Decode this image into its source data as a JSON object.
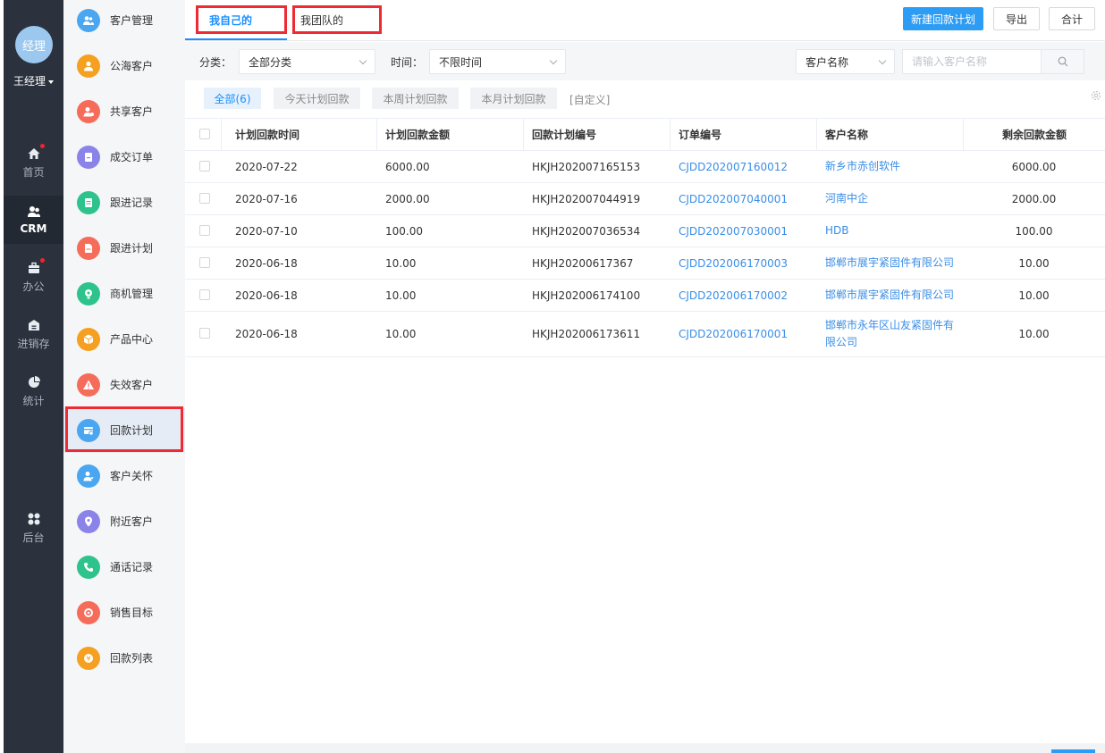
{
  "user": {
    "avatar_text": "经理",
    "name": "王经理"
  },
  "rail": [
    {
      "label": "首页",
      "icon": "home-icon",
      "badge": true
    },
    {
      "label": "CRM",
      "icon": "crm-icon",
      "badge": false,
      "active": true
    },
    {
      "label": "办公",
      "icon": "briefcase-icon",
      "badge": true
    },
    {
      "label": "进销存",
      "icon": "warehouse-icon",
      "badge": false
    },
    {
      "label": "统计",
      "icon": "pie-chart-icon",
      "badge": false
    },
    {
      "label": "后台",
      "icon": "admin-grid-icon",
      "badge": false
    }
  ],
  "menu": [
    {
      "label": "客户管理",
      "icon": "customers-icon",
      "color": "#4aa6f0"
    },
    {
      "label": "公海客户",
      "icon": "public-pool-icon",
      "color": "#f5a020"
    },
    {
      "label": "共享客户",
      "icon": "shared-customers-icon",
      "color": "#f56c5a"
    },
    {
      "label": "成交订单",
      "icon": "order-icon",
      "color": "#8b84e8"
    },
    {
      "label": "跟进记录",
      "icon": "follow-record-icon",
      "color": "#2ec38c"
    },
    {
      "label": "跟进计划",
      "icon": "follow-plan-icon",
      "color": "#f56c5a"
    },
    {
      "label": "商机管理",
      "icon": "opportunity-icon",
      "color": "#2ec38c"
    },
    {
      "label": "产品中心",
      "icon": "product-icon",
      "color": "#f5a020"
    },
    {
      "label": "失效客户",
      "icon": "warning-icon",
      "color": "#f56c5a"
    },
    {
      "label": "回款计划",
      "icon": "payment-plan-icon",
      "color": "#4aa6f0",
      "active": true
    },
    {
      "label": "客户关怀",
      "icon": "customer-care-icon",
      "color": "#4aa6f0"
    },
    {
      "label": "附近客户",
      "icon": "location-icon",
      "color": "#8b84e8"
    },
    {
      "label": "通话记录",
      "icon": "phone-icon",
      "color": "#2ec38c"
    },
    {
      "label": "销售目标",
      "icon": "target-icon",
      "color": "#f56c5a"
    },
    {
      "label": "回款列表",
      "icon": "payment-list-icon",
      "color": "#f5a020"
    }
  ],
  "tabs": {
    "mine": "我自己的",
    "team": "我团队的"
  },
  "buttons": {
    "new_plan": "新建回款计划",
    "export": "导出",
    "total": "合计"
  },
  "filters": {
    "category_label": "分类：",
    "category_value": "全部分类",
    "time_label": "时间：",
    "time_value": "不限时间",
    "search_field": "客户名称",
    "search_placeholder": "请输入客户名称"
  },
  "quick": {
    "all": "全部(6)",
    "today": "今天计划回款",
    "week": "本周计划回款",
    "month": "本月计划回款",
    "custom": "[自定义]"
  },
  "table": {
    "headers": {
      "date": "计划回款时间",
      "amount": "计划回款金额",
      "plan_no": "回款计划编号",
      "order_no": "订单编号",
      "customer": "客户名称",
      "remaining": "剩余回款金额"
    },
    "rows": [
      {
        "date": "2020-07-22",
        "amount": "6000.00",
        "plan_no": "HKJH202007165153",
        "order_no": "CJDD202007160012",
        "customer": "新乡市赤创软件",
        "remaining": "6000.00"
      },
      {
        "date": "2020-07-16",
        "amount": "2000.00",
        "plan_no": "HKJH202007044919",
        "order_no": "CJDD202007040001",
        "customer": "河南中企",
        "remaining": "2000.00"
      },
      {
        "date": "2020-07-10",
        "amount": "100.00",
        "plan_no": "HKJH202007036534",
        "order_no": "CJDD202007030001",
        "customer": "HDB",
        "remaining": "100.00"
      },
      {
        "date": "2020-06-18",
        "amount": "10.00",
        "plan_no": "HKJH20200617367",
        "order_no": "CJDD202006170003",
        "customer": "邯郸市展宇紧固件有限公司",
        "remaining": "10.00"
      },
      {
        "date": "2020-06-18",
        "amount": "10.00",
        "plan_no": "HKJH202006174100",
        "order_no": "CJDD202006170002",
        "customer": "邯郸市展宇紧固件有限公司",
        "remaining": "10.00"
      },
      {
        "date": "2020-06-18",
        "amount": "10.00",
        "plan_no": "HKJH202006173611",
        "order_no": "CJDD202006170001",
        "customer": "邯郸市永年区山友紧固件有限公司",
        "remaining": "10.00"
      }
    ]
  },
  "colors": {
    "accent": "#1890ff",
    "highlight_box": "#ee2b33",
    "rail_bg": "#2b323d"
  }
}
